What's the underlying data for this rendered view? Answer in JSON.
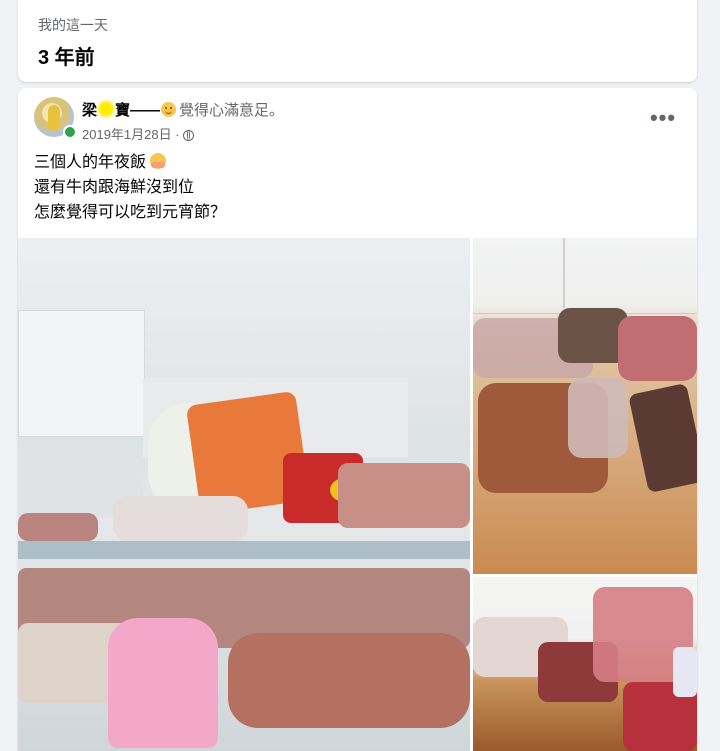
{
  "memory": {
    "label": "我的這一天",
    "title": "3 年前"
  },
  "post": {
    "author_prefix": "梁",
    "author_suffix": "寶",
    "dash": "——",
    "feeling": "覺得心滿意足。",
    "date": "2019年1月28日",
    "separator": "·",
    "more_label": "•••",
    "lines": [
      "三個人的年夜飯",
      "還有牛肉跟海鮮沒到位",
      "怎麼覺得可以吃到元宵節？"
    ]
  },
  "icons": [
    "smile-icon",
    "globe-icon",
    "more-options-icon",
    "hug-emoji-icon"
  ],
  "colors": {
    "online": "#31a24c",
    "secondary_text": "#65676b",
    "background": "#f0f2f5"
  }
}
